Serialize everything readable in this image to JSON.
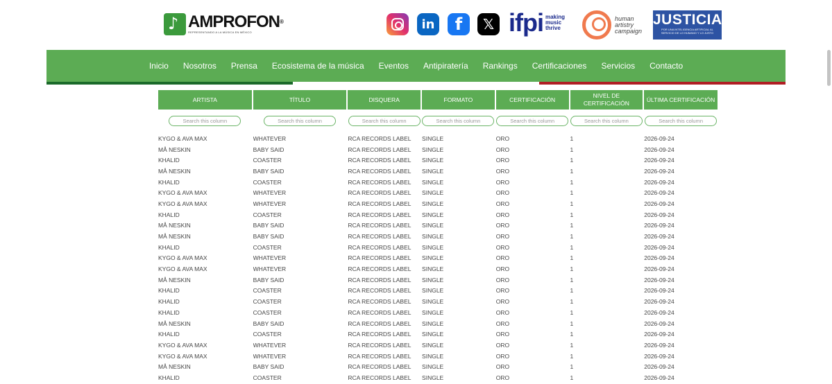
{
  "header": {
    "logo": {
      "name": "AMPROFON",
      "reg": "®",
      "tagline": "REPRESENTANDO A LA MÚSICA EN MÉXICO"
    },
    "social": [
      {
        "name": "instagram-icon",
        "glyph": ""
      },
      {
        "name": "linkedin-icon",
        "glyph": "in"
      },
      {
        "name": "facebook-icon",
        "glyph": "f"
      },
      {
        "name": "x-icon",
        "glyph": "𝕏"
      }
    ],
    "ifpi": {
      "word": "ifpi",
      "tagline": "making music thrive"
    },
    "hac": {
      "line1": "human",
      "line2": "artistry",
      "line3": "campaign"
    },
    "justicia": {
      "title": "JUSTICIA",
      "subtitle": "POR UNA INTELIGENCIA ARTIFICIAL AL SERVICIO DE LO HUMANO Y LO JUSTO"
    }
  },
  "nav": {
    "items": [
      "Inicio",
      "Nosotros",
      "Prensa",
      "Ecosistema de la música",
      "Eventos",
      "Antipiratería",
      "Rankings",
      "Certificaciones",
      "Servicios",
      "Contacto"
    ]
  },
  "colors": {
    "brand_green": "#5cac54",
    "flag_green": "#1b6a2a",
    "flag_red": "#b01e24"
  },
  "table": {
    "columns": [
      "ARTISTA",
      "TÍTULO",
      "DISQUERA",
      "FORMATO",
      "CERTIFICACIÓN",
      "NIVEL DE CERTIFICACIÓN",
      "ÚLTIMA CERTIFICACIÓN"
    ],
    "filter_placeholder": "Search this column",
    "rows": [
      [
        "KYGO & AVA MAX",
        "WHATEVER",
        "RCA RECORDS LABEL",
        "SINGLE",
        "ORO",
        "1",
        "2026-09-24"
      ],
      [
        "MÅ NESKIN",
        "BABY SAID",
        "RCA RECORDS LABEL",
        "SINGLE",
        "ORO",
        "1",
        "2026-09-24"
      ],
      [
        "KHALID",
        "COASTER",
        "RCA RECORDS LABEL",
        "SINGLE",
        "ORO",
        "1",
        "2026-09-24"
      ],
      [
        "MÅ NESKIN",
        "BABY SAID",
        "RCA RECORDS LABEL",
        "SINGLE",
        "ORO",
        "1",
        "2026-09-24"
      ],
      [
        "KHALID",
        "COASTER",
        "RCA RECORDS LABEL",
        "SINGLE",
        "ORO",
        "1",
        "2026-09-24"
      ],
      [
        "KYGO & AVA MAX",
        "WHATEVER",
        "RCA RECORDS LABEL",
        "SINGLE",
        "ORO",
        "1",
        "2026-09-24"
      ],
      [
        "KYGO & AVA MAX",
        "WHATEVER",
        "RCA RECORDS LABEL",
        "SINGLE",
        "ORO",
        "1",
        "2026-09-24"
      ],
      [
        "KHALID",
        "COASTER",
        "RCA RECORDS LABEL",
        "SINGLE",
        "ORO",
        "1",
        "2026-09-24"
      ],
      [
        "MÅ NESKIN",
        "BABY SAID",
        "RCA RECORDS LABEL",
        "SINGLE",
        "ORO",
        "1",
        "2026-09-24"
      ],
      [
        "MÅ NESKIN",
        "BABY SAID",
        "RCA RECORDS LABEL",
        "SINGLE",
        "ORO",
        "1",
        "2026-09-24"
      ],
      [
        "KHALID",
        "COASTER",
        "RCA RECORDS LABEL",
        "SINGLE",
        "ORO",
        "1",
        "2026-09-24"
      ],
      [
        "KYGO & AVA MAX",
        "WHATEVER",
        "RCA RECORDS LABEL",
        "SINGLE",
        "ORO",
        "1",
        "2026-09-24"
      ],
      [
        "KYGO & AVA MAX",
        "WHATEVER",
        "RCA RECORDS LABEL",
        "SINGLE",
        "ORO",
        "1",
        "2026-09-24"
      ],
      [
        "MÅ NESKIN",
        "BABY SAID",
        "RCA RECORDS LABEL",
        "SINGLE",
        "ORO",
        "1",
        "2026-09-24"
      ],
      [
        "KHALID",
        "COASTER",
        "RCA RECORDS LABEL",
        "SINGLE",
        "ORO",
        "1",
        "2026-09-24"
      ],
      [
        "KHALID",
        "COASTER",
        "RCA RECORDS LABEL",
        "SINGLE",
        "ORO",
        "1",
        "2026-09-24"
      ],
      [
        "KHALID",
        "COASTER",
        "RCA RECORDS LABEL",
        "SINGLE",
        "ORO",
        "1",
        "2026-09-24"
      ],
      [
        "MÅ NESKIN",
        "BABY SAID",
        "RCA RECORDS LABEL",
        "SINGLE",
        "ORO",
        "1",
        "2026-09-24"
      ],
      [
        "KHALID",
        "COASTER",
        "RCA RECORDS LABEL",
        "SINGLE",
        "ORO",
        "1",
        "2026-09-24"
      ],
      [
        "KYGO & AVA MAX",
        "WHATEVER",
        "RCA RECORDS LABEL",
        "SINGLE",
        "ORO",
        "1",
        "2026-09-24"
      ],
      [
        "KYGO & AVA MAX",
        "WHATEVER",
        "RCA RECORDS LABEL",
        "SINGLE",
        "ORO",
        "1",
        "2026-09-24"
      ],
      [
        "MÅ NESKIN",
        "BABY SAID",
        "RCA RECORDS LABEL",
        "SINGLE",
        "ORO",
        "1",
        "2026-09-24"
      ],
      [
        "KHALID",
        "COASTER",
        "RCA RECORDS LABEL",
        "SINGLE",
        "ORO",
        "1",
        "2026-09-24"
      ]
    ]
  }
}
